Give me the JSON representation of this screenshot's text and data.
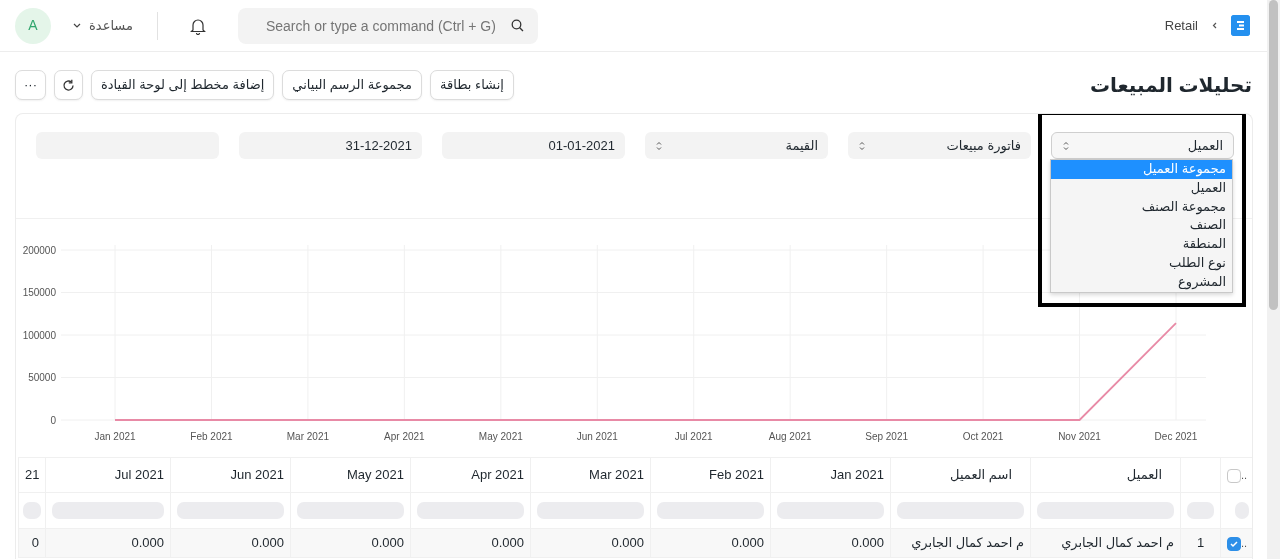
{
  "navbar": {
    "breadcrumb": "Retail",
    "search": {
      "placeholder": "Search or type a command (Ctrl + G)"
    },
    "help": "مساعدة",
    "avatar": "A"
  },
  "page": {
    "title": "تحليلات المبيعات",
    "buttons": [
      "إنشاء بطاقة",
      "مجموعة الرسم البياني",
      "إضافة مخطط إلى لوحة القيادة"
    ],
    "more": "···"
  },
  "filters": [
    {
      "kind": "select",
      "value": "العميل",
      "open": true,
      "highlighted": true
    },
    {
      "kind": "select",
      "value": "فاتورة مبيعات"
    },
    {
      "kind": "select",
      "value": "القيمة"
    },
    {
      "kind": "date",
      "value": "01-01-2021"
    },
    {
      "kind": "date",
      "value": "31-12-2021"
    },
    {
      "kind": "blank"
    }
  ],
  "dropdown": {
    "options": [
      {
        "label": "مجموعة العميل",
        "selected": true
      },
      {
        "label": "العميل",
        "selected": false
      },
      {
        "label": "مجموعة الصنف",
        "selected": false
      },
      {
        "label": "الصنف",
        "selected": false
      },
      {
        "label": "المنطقة",
        "selected": false
      },
      {
        "label": "نوع الطلب",
        "selected": false
      },
      {
        "label": "المشروع",
        "selected": false
      }
    ]
  },
  "chart_data": {
    "type": "line",
    "categories": [
      "Jan 2021",
      "Feb 2021",
      "Mar 2021",
      "Apr 2021",
      "May 2021",
      "Jun 2021",
      "Jul 2021",
      "Aug 2021",
      "Sep 2021",
      "Oct 2021",
      "Nov 2021",
      "Dec 2021"
    ],
    "series": [
      {
        "color": "#e88aa6",
        "values": [
          0,
          0,
          0,
          0,
          0,
          0,
          0,
          0,
          0,
          0,
          0,
          114000
        ]
      }
    ],
    "grid": true,
    "ylim": [
      0,
      200000
    ],
    "yticks": [
      0,
      50000,
      100000,
      150000,
      200000
    ]
  },
  "table": {
    "all_checked": false,
    "header_handle": "..",
    "columns": [
      "العميل",
      "اسم العميل",
      "Jan 2021",
      "Feb 2021",
      "Mar 2021",
      "Apr 2021",
      "May 2021",
      "Jun 2021",
      "Jul 2021",
      "21"
    ],
    "rows": [
      {
        "handle": "..",
        "checked": true,
        "number": "1",
        "cells": [
          "م احمد كمال الجابري",
          "م احمد كمال الجابري",
          "0.000",
          "0.000",
          "0.000",
          "0.000",
          "0.000",
          "0.000",
          "0.000",
          "0"
        ]
      }
    ]
  }
}
